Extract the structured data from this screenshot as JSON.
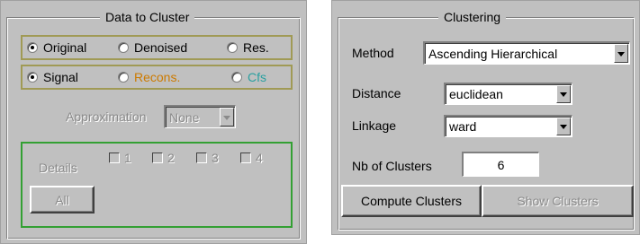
{
  "data_to_cluster": {
    "title": "Data to Cluster",
    "source_options": [
      "Original",
      "Denoised",
      "Res."
    ],
    "source_selected": "Original",
    "type_options": [
      "Signal",
      "Recons.",
      "Cfs"
    ],
    "type_selected": "Signal",
    "approximation_label": "Approximation",
    "approximation_value": "None",
    "details_label": "Details",
    "details_levels": [
      "1",
      "2",
      "3",
      "4"
    ],
    "all_button": "All"
  },
  "clustering": {
    "title": "Clustering",
    "method_label": "Method",
    "method_value": "Ascending Hierarchical",
    "distance_label": "Distance",
    "distance_value": "euclidean",
    "linkage_label": "Linkage",
    "linkage_value": "ward",
    "nb_clusters_label": "Nb of Clusters",
    "nb_clusters_value": "6",
    "compute_button": "Compute Clusters",
    "show_button": "Show Clusters"
  },
  "colors": {
    "panel_background": "#c0c0c0",
    "type_group_border": "#a09a55",
    "details_group_border": "#33a033",
    "recons_text": "#cc7a00",
    "cfs_text": "#2aa0a0",
    "disabled_text": "#8a8a8a"
  }
}
